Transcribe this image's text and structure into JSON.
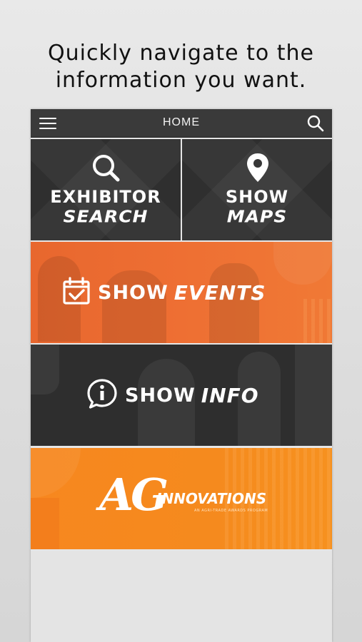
{
  "headline": {
    "line1": "Quickly navigate to the",
    "line2": "information you want."
  },
  "topbar": {
    "title": "HOME",
    "menu_icon": "hamburger-menu-icon",
    "search_icon": "search-icon"
  },
  "tiles": {
    "exhibitor": {
      "line1": "EXHIBITOR",
      "line2": "SEARCH",
      "icon": "magnifier-icon"
    },
    "maps": {
      "line1": "SHOW",
      "line2": "MAPS",
      "icon": "map-pin-icon"
    },
    "events": {
      "word1": "SHOW",
      "word2": "EVENTS",
      "icon": "calendar-check-icon"
    },
    "info": {
      "word1": "SHOW",
      "word2": "INFO",
      "icon": "info-bubble-icon"
    },
    "ag": {
      "big": "AG",
      "word": "INNOVATIONS",
      "sub": "AN AGRI-TRADE AWARDS PROGRAM"
    }
  },
  "colors": {
    "topbar": "#3a3a3a",
    "dark_tile": "#2f2f2f",
    "events_orange": "#ee6f33",
    "ag_orange": "#f58a1e",
    "text": "#ffffff"
  }
}
